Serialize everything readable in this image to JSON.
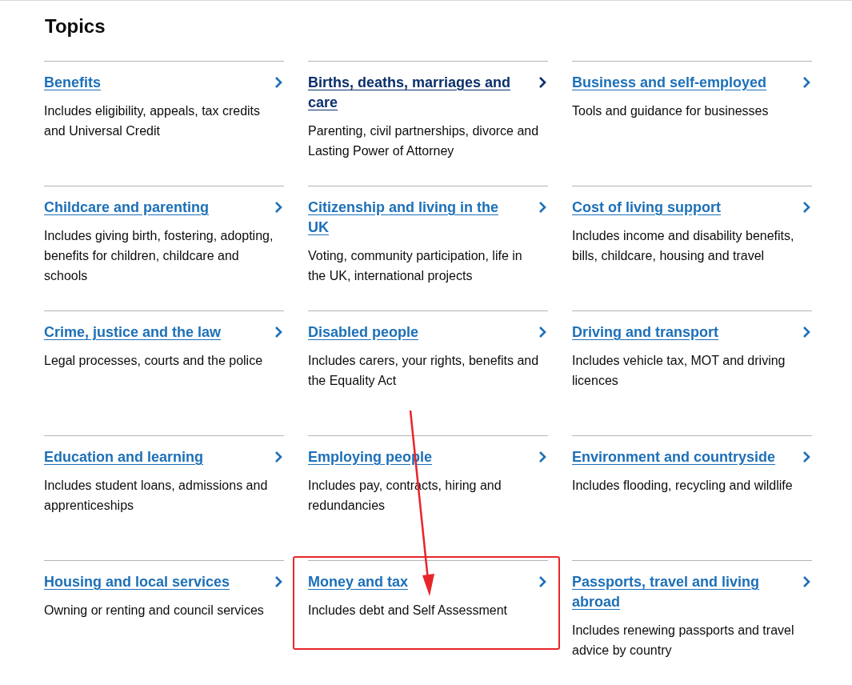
{
  "heading": "Topics",
  "topics": [
    {
      "title": "Benefits",
      "description": "Includes eligibility, appeals, tax credits and Universal Credit",
      "visited": false,
      "highlighted": false
    },
    {
      "title": "Births, deaths, marriages and care",
      "description": "Parenting, civil partnerships, divorce and Lasting Power of Attorney",
      "visited": true,
      "highlighted": false
    },
    {
      "title": "Business and self-employed",
      "description": "Tools and guidance for businesses",
      "visited": false,
      "highlighted": false
    },
    {
      "title": "Childcare and parenting",
      "description": "Includes giving birth, fostering, adopting, benefits for children, childcare and schools",
      "visited": false,
      "highlighted": false
    },
    {
      "title": "Citizenship and living in the UK",
      "description": "Voting, community participation, life in the UK, international projects",
      "visited": false,
      "highlighted": false
    },
    {
      "title": "Cost of living support",
      "description": "Includes income and disability benefits, bills, childcare, housing and travel",
      "visited": false,
      "highlighted": false
    },
    {
      "title": "Crime, justice and the law",
      "description": "Legal processes, courts and the police",
      "visited": false,
      "highlighted": false
    },
    {
      "title": "Disabled people",
      "description": "Includes carers, your rights, benefits and the Equality Act",
      "visited": false,
      "highlighted": false
    },
    {
      "title": "Driving and transport",
      "description": "Includes vehicle tax, MOT and driving licences",
      "visited": false,
      "highlighted": false
    },
    {
      "title": "Education and learning",
      "description": "Includes student loans, admissions and apprenticeships",
      "visited": false,
      "highlighted": false
    },
    {
      "title": "Employing people",
      "description": "Includes pay, contracts, hiring and redundancies",
      "visited": false,
      "highlighted": false
    },
    {
      "title": "Environment and countryside",
      "description": "Includes flooding, recycling and wildlife",
      "visited": false,
      "highlighted": false
    },
    {
      "title": "Housing and local services",
      "description": "Owning or renting and council services",
      "visited": false,
      "highlighted": false
    },
    {
      "title": "Money and tax",
      "description": "Includes debt and Self Assessment",
      "visited": false,
      "highlighted": true
    },
    {
      "title": "Passports, travel and living abroad",
      "description": "Includes renewing passports and travel advice by country",
      "visited": false,
      "highlighted": false
    }
  ]
}
